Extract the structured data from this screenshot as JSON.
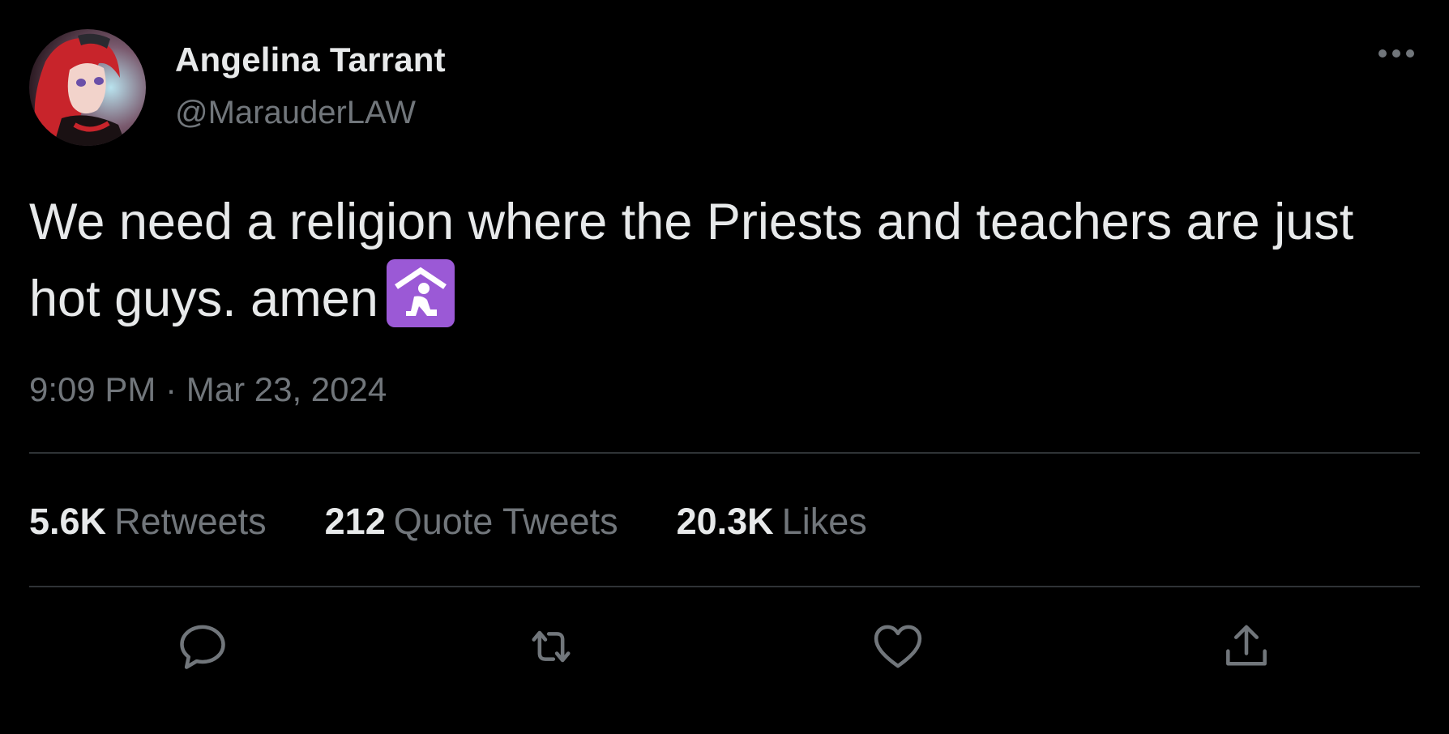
{
  "author": {
    "display_name": "Angelina Tarrant",
    "handle": "@MarauderLAW",
    "avatar_icon": "anime-avatar"
  },
  "tweet": {
    "text": "We need a religion where the Priests and teachers are just hot guys. amen",
    "emoji": "place-of-worship-emoji",
    "timestamp": "9:09 PM · Mar 23, 2024"
  },
  "stats": {
    "retweets_count": "5.6K",
    "retweets_label": "Retweets",
    "quotes_count": "212",
    "quotes_label": "Quote Tweets",
    "likes_count": "20.3K",
    "likes_label": "Likes"
  },
  "actions": {
    "reply": "reply-icon",
    "retweet": "retweet-icon",
    "like": "heart-icon",
    "share": "share-icon",
    "more": "more-icon"
  },
  "colors": {
    "background": "#000000",
    "primary_text": "#e7e9ea",
    "secondary_text": "#71767b",
    "divider": "#2f3336",
    "emoji_bg": "#9b59d6"
  }
}
